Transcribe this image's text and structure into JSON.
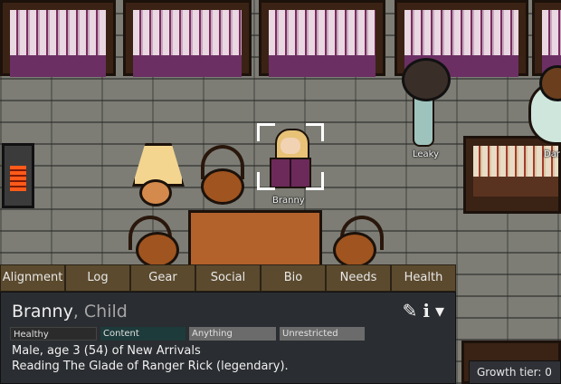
{
  "scene": {
    "pawns": [
      {
        "label": "Branny"
      },
      {
        "label": "Leaky"
      },
      {
        "label": "Dar"
      }
    ]
  },
  "tabs": [
    "Alignment",
    "Log",
    "Gear",
    "Social",
    "Bio",
    "Needs",
    "Health"
  ],
  "inspect": {
    "name": "Branny",
    "subtitle": ", Child",
    "bars": [
      {
        "label": "Healthy",
        "color": "#2b2b2b"
      },
      {
        "label": "Content",
        "color": "#1e3b3b"
      },
      {
        "label": "Anything",
        "color": "#6b6b6b"
      },
      {
        "label": "Unrestricted",
        "color": "#6b6b6b"
      }
    ],
    "line1": "Male, age 3 (54) of New Arrivals",
    "line2": "Reading The Glade of Ranger Rick (legendary).",
    "icons": [
      "rename-icon",
      "info-icon",
      "collapse-icon"
    ]
  },
  "growth": {
    "text": "Growth tier: 0"
  }
}
